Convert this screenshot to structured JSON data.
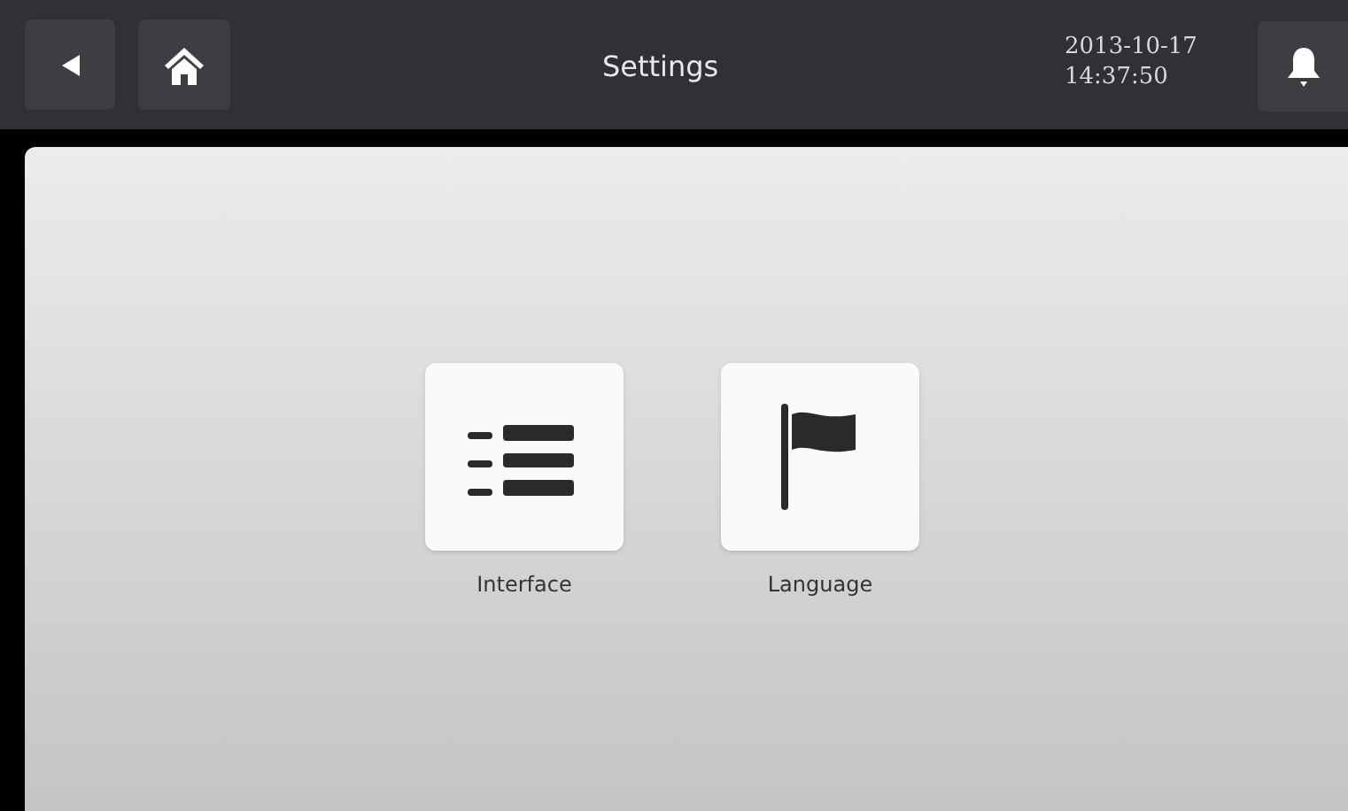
{
  "header": {
    "title": "Settings",
    "date": "2013-10-17",
    "time": "14:37:50"
  },
  "tiles": [
    {
      "label": "Interface",
      "kind": "list"
    },
    {
      "label": "Language",
      "kind": "flag"
    }
  ]
}
